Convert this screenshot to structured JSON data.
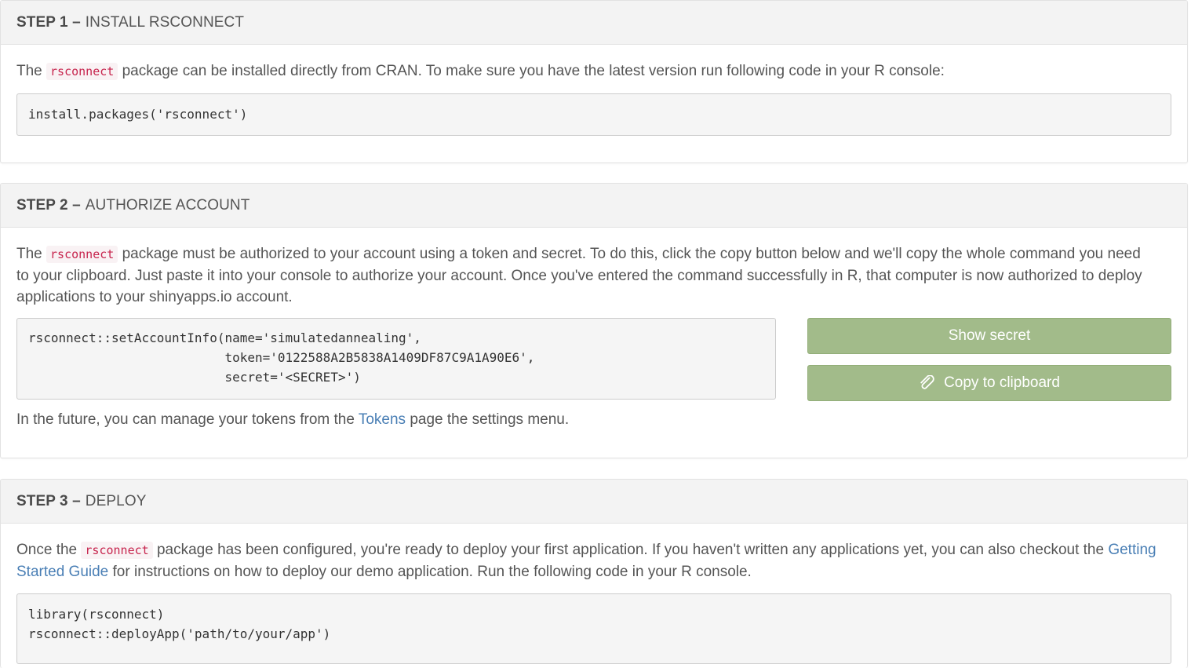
{
  "step1": {
    "step_label": "STEP 1 –",
    "title": "INSTALL RSCONNECT",
    "text_before": "The",
    "inline_code": "rsconnect",
    "text_after": "package can be installed directly from CRAN. To make sure you have the latest version run following code in your R console:",
    "code": "install.packages('rsconnect')"
  },
  "step2": {
    "step_label": "STEP 2 –",
    "title": "AUTHORIZE ACCOUNT",
    "text_before": "The",
    "inline_code": "rsconnect",
    "text_after": "package must be authorized to your account using a token and secret. To do this, click the copy button below and we'll copy the whole command you need to your clipboard. Just paste it into your console to authorize your account. Once you've entered the command successfully in R, that computer is now authorized to deploy applications to your shinyapps.io account.",
    "code": "rsconnect::setAccountInfo(name='simulatedannealing',\n\t\t\t  token='0122588A2B5838A1409DF87C9A1A90E6',\n\t\t\t  secret='<SECRET>')",
    "show_secret_label": "Show secret",
    "copy_label": "Copy to clipboard",
    "footer_before": "In the future, you can manage your tokens from the",
    "footer_link": "Tokens",
    "footer_after": "page the settings menu."
  },
  "step3": {
    "step_label": "STEP 3 –",
    "title": "DEPLOY",
    "text_before": "Once the",
    "inline_code": "rsconnect",
    "text_mid": "package has been configured, you're ready to deploy your first application. If you haven't written any applications yet, you can also checkout the",
    "guide_link": "Getting Started Guide",
    "text_after": "for instructions on how to deploy our demo application. Run the following code in your R console.",
    "code": "library(rsconnect)\nrsconnect::deployApp('path/to/your/app')"
  },
  "colors": {
    "button_bg": "#a2bb8a",
    "link": "#4a7fb5",
    "inline_code": "#c7254e"
  }
}
